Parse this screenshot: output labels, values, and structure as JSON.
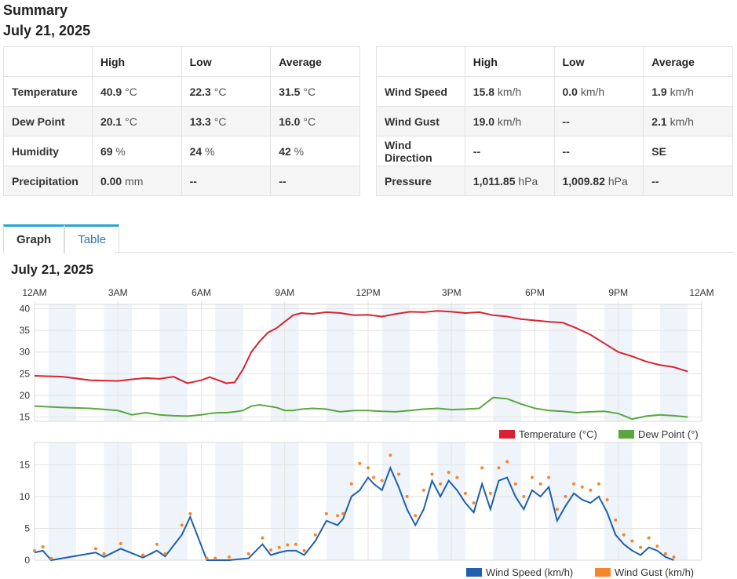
{
  "summary": {
    "title": "Summary",
    "date": "July 21, 2025"
  },
  "left_table": {
    "headers": [
      "",
      "High",
      "Low",
      "Average"
    ],
    "rows": [
      {
        "label": "Temperature",
        "cells": [
          {
            "v": "40.9",
            "u": "°C"
          },
          {
            "v": "22.3",
            "u": "°C"
          },
          {
            "v": "31.5",
            "u": "°C"
          }
        ]
      },
      {
        "label": "Dew Point",
        "cells": [
          {
            "v": "20.1",
            "u": "°C"
          },
          {
            "v": "13.3",
            "u": "°C"
          },
          {
            "v": "16.0",
            "u": "°C"
          }
        ]
      },
      {
        "label": "Humidity",
        "cells": [
          {
            "v": "69",
            "u": "%"
          },
          {
            "v": "24",
            "u": "%"
          },
          {
            "v": "42",
            "u": "%"
          }
        ]
      },
      {
        "label": "Precipitation",
        "cells": [
          {
            "v": "0.00",
            "u": "mm"
          },
          {
            "v": "--",
            "u": ""
          },
          {
            "v": "--",
            "u": ""
          }
        ]
      }
    ]
  },
  "right_table": {
    "headers": [
      "",
      "High",
      "Low",
      "Average"
    ],
    "rows": [
      {
        "label": "Wind Speed",
        "cells": [
          {
            "v": "15.8",
            "u": "km/h"
          },
          {
            "v": "0.0",
            "u": "km/h"
          },
          {
            "v": "1.9",
            "u": "km/h"
          }
        ]
      },
      {
        "label": "Wind Gust",
        "cells": [
          {
            "v": "19.0",
            "u": "km/h"
          },
          {
            "v": "--",
            "u": ""
          },
          {
            "v": "2.1",
            "u": "km/h"
          }
        ]
      },
      {
        "label": "Wind Direction",
        "cells": [
          {
            "v": "--",
            "u": ""
          },
          {
            "v": "--",
            "u": ""
          },
          {
            "v": "SE",
            "u": ""
          }
        ]
      },
      {
        "label": "Pressure",
        "cells": [
          {
            "v": "1,011.85",
            "u": "hPa"
          },
          {
            "v": "1,009.82",
            "u": "hPa"
          },
          {
            "v": "--",
            "u": ""
          }
        ]
      }
    ]
  },
  "tabs": [
    {
      "label": "Graph",
      "active": true
    },
    {
      "label": "Table",
      "active": false
    }
  ],
  "graph": {
    "title": "July 21, 2025"
  },
  "chart_data": [
    {
      "type": "line",
      "x_ticks": [
        "12AM",
        "3AM",
        "6AM",
        "9AM",
        "12PM",
        "3PM",
        "6PM",
        "9PM",
        "12AM"
      ],
      "ylim": [
        14,
        41
      ],
      "y_ticks": [
        15,
        20,
        25,
        30,
        35,
        40
      ],
      "grid": true,
      "legend": "bottom-right",
      "x_hours": [
        0,
        1,
        2,
        3,
        3.5,
        4,
        4.5,
        5,
        5.5,
        6,
        6.3,
        6.6,
        6.9,
        7.2,
        7.5,
        7.8,
        8.1,
        8.4,
        8.7,
        9,
        9.3,
        9.6,
        10,
        10.5,
        11,
        11.5,
        12,
        12.5,
        13,
        13.5,
        14,
        14.5,
        15,
        15.5,
        16,
        16.5,
        17,
        17.5,
        18,
        18.5,
        19,
        19.5,
        20,
        20.5,
        21,
        21.5,
        22,
        22.5,
        23,
        23.5
      ],
      "series": [
        {
          "name": "Temperature (°C)",
          "color": "#d92231",
          "values": [
            24.5,
            24.3,
            23.5,
            23.3,
            23.7,
            24,
            23.8,
            24.3,
            22.8,
            23.5,
            24.2,
            23.5,
            22.8,
            23,
            26,
            30,
            32.5,
            34.5,
            35.5,
            37,
            38.5,
            39,
            38.8,
            39.2,
            39,
            38.5,
            38.6,
            38.2,
            38.8,
            39.3,
            39.2,
            39.5,
            39.3,
            39,
            39.2,
            38.5,
            38.2,
            37.6,
            37.3,
            37,
            36.8,
            35.5,
            34,
            32,
            30,
            29,
            27.8,
            27,
            26.5,
            25.5
          ]
        },
        {
          "name": "Dew Point (°)",
          "color": "#5ba640",
          "values": [
            17.5,
            17.2,
            17,
            16.5,
            15.5,
            16,
            15.5,
            15.3,
            15.2,
            15.5,
            15.8,
            16,
            16,
            16.2,
            16.5,
            17.5,
            17.8,
            17.5,
            17.2,
            16.5,
            16.5,
            16.8,
            17,
            16.8,
            16.2,
            16.5,
            16.5,
            16.3,
            16.2,
            16.5,
            16.8,
            17,
            16.7,
            16.8,
            17,
            19.5,
            19.2,
            18,
            17,
            16.5,
            16.3,
            16,
            16.2,
            16.3,
            15.8,
            14.5,
            15.2,
            15.5,
            15.3,
            15
          ]
        }
      ]
    },
    {
      "type": "line",
      "ylim": [
        0,
        18.5
      ],
      "y_ticks": [
        0,
        5,
        10,
        15
      ],
      "grid": true,
      "legend": "bottom-right",
      "x_hours": [
        0,
        0.3,
        0.6,
        2.2,
        2.5,
        3.1,
        3.9,
        4.4,
        4.7,
        5.3,
        5.6,
        6.2,
        6.5,
        7,
        7.7,
        8.2,
        8.5,
        8.8,
        9.1,
        9.4,
        9.7,
        10.1,
        10.5,
        10.9,
        11.1,
        11.4,
        11.7,
        12,
        12.2,
        12.5,
        12.8,
        13.1,
        13.4,
        13.7,
        14,
        14.3,
        14.6,
        14.9,
        15.2,
        15.5,
        15.8,
        16.1,
        16.4,
        16.7,
        17,
        17.3,
        17.6,
        17.9,
        18.2,
        18.5,
        18.8,
        19.1,
        19.4,
        19.7,
        20,
        20.3,
        20.6,
        20.9,
        21.2,
        21.5,
        21.8,
        22.1,
        22.4,
        22.7,
        23
      ],
      "series": [
        {
          "name": "Wind Speed (km/h)",
          "color": "#1f5fae",
          "values": [
            1.2,
            1.5,
            0,
            1.2,
            0.5,
            1.8,
            0.4,
            1.5,
            0.6,
            4,
            6.8,
            0,
            0,
            0,
            0.3,
            2.5,
            0.8,
            1.2,
            1.5,
            1.5,
            0.8,
            3,
            6.2,
            5.5,
            6.5,
            10,
            11,
            13,
            12,
            11,
            14.5,
            11.5,
            8,
            5.5,
            8,
            12.5,
            10,
            12.5,
            11,
            9,
            7.5,
            12,
            8,
            12.5,
            13,
            10,
            8,
            11,
            10,
            11.5,
            6.2,
            8.5,
            10.5,
            9.5,
            9,
            10,
            7.5,
            4,
            2.5,
            1.5,
            0.8,
            2,
            1.5,
            0.5,
            0
          ]
        },
        {
          "name": "Wind Gust (km/h)",
          "color": "#f5862c",
          "values": [
            1.5,
            2.1,
            0.3,
            1.8,
            1,
            2.6,
            0.8,
            2.5,
            1,
            5.5,
            7.3,
            0.3,
            0.3,
            0.5,
            1,
            3.5,
            1.6,
            2,
            2.4,
            2.5,
            1.5,
            4,
            7.3,
            7,
            7.3,
            12,
            15.2,
            14.5,
            13,
            12.5,
            16.5,
            13.5,
            10,
            7,
            11,
            13.5,
            12,
            13.8,
            13,
            10.5,
            9,
            14.5,
            10.5,
            14.5,
            15.5,
            12,
            10,
            13,
            12,
            13,
            8,
            10,
            12,
            11.5,
            11,
            12,
            9.5,
            6.3,
            4,
            3,
            2,
            3.5,
            2.2,
            1,
            0.5
          ]
        }
      ]
    }
  ]
}
